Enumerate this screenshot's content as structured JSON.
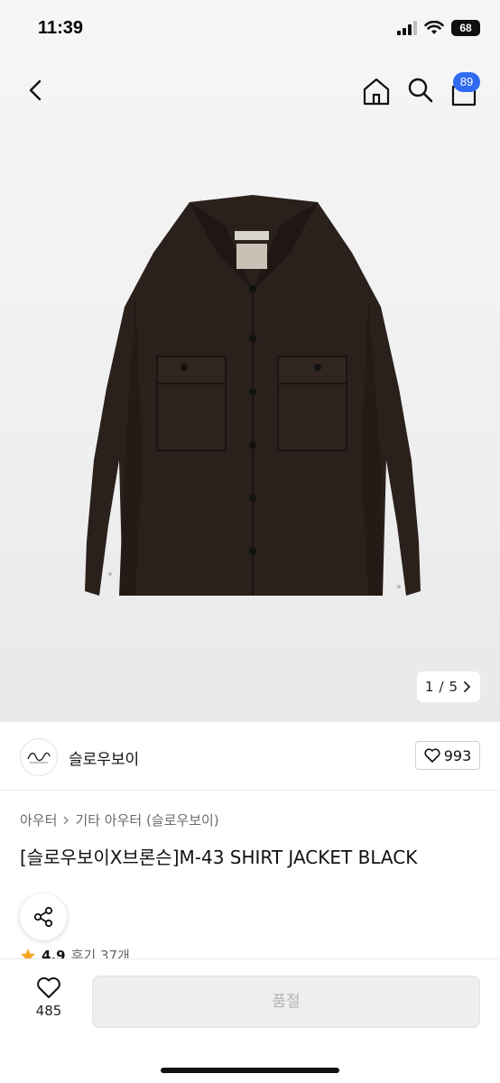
{
  "status_bar": {
    "time": "11:39",
    "battery": "68"
  },
  "nav": {
    "cart_badge": "89"
  },
  "gallery": {
    "current": "1",
    "separator": "/",
    "total": "5"
  },
  "brand": {
    "name": "슬로우보이",
    "likes": "993"
  },
  "breadcrumb": {
    "items": [
      "아우터",
      "기타 아우터 (슬로우보이)"
    ]
  },
  "product": {
    "title": "[슬로우보이X브론슨]M-43 SHIRT JACKET BLACK",
    "rating": "4.9",
    "reviews": "후기 37개"
  },
  "bottom_bar": {
    "wish_count": "485",
    "soldout_label": "품절"
  },
  "colors": {
    "accent_blue": "#2f6cf0",
    "jacket": "#2a201c",
    "star": "#f5a623"
  },
  "icons": [
    "back-chevron-icon",
    "home-icon",
    "search-icon",
    "cart-icon",
    "heart-icon",
    "share-icon",
    "star-icon",
    "chevron-right-icon",
    "wifi-icon",
    "signal-icon"
  ]
}
